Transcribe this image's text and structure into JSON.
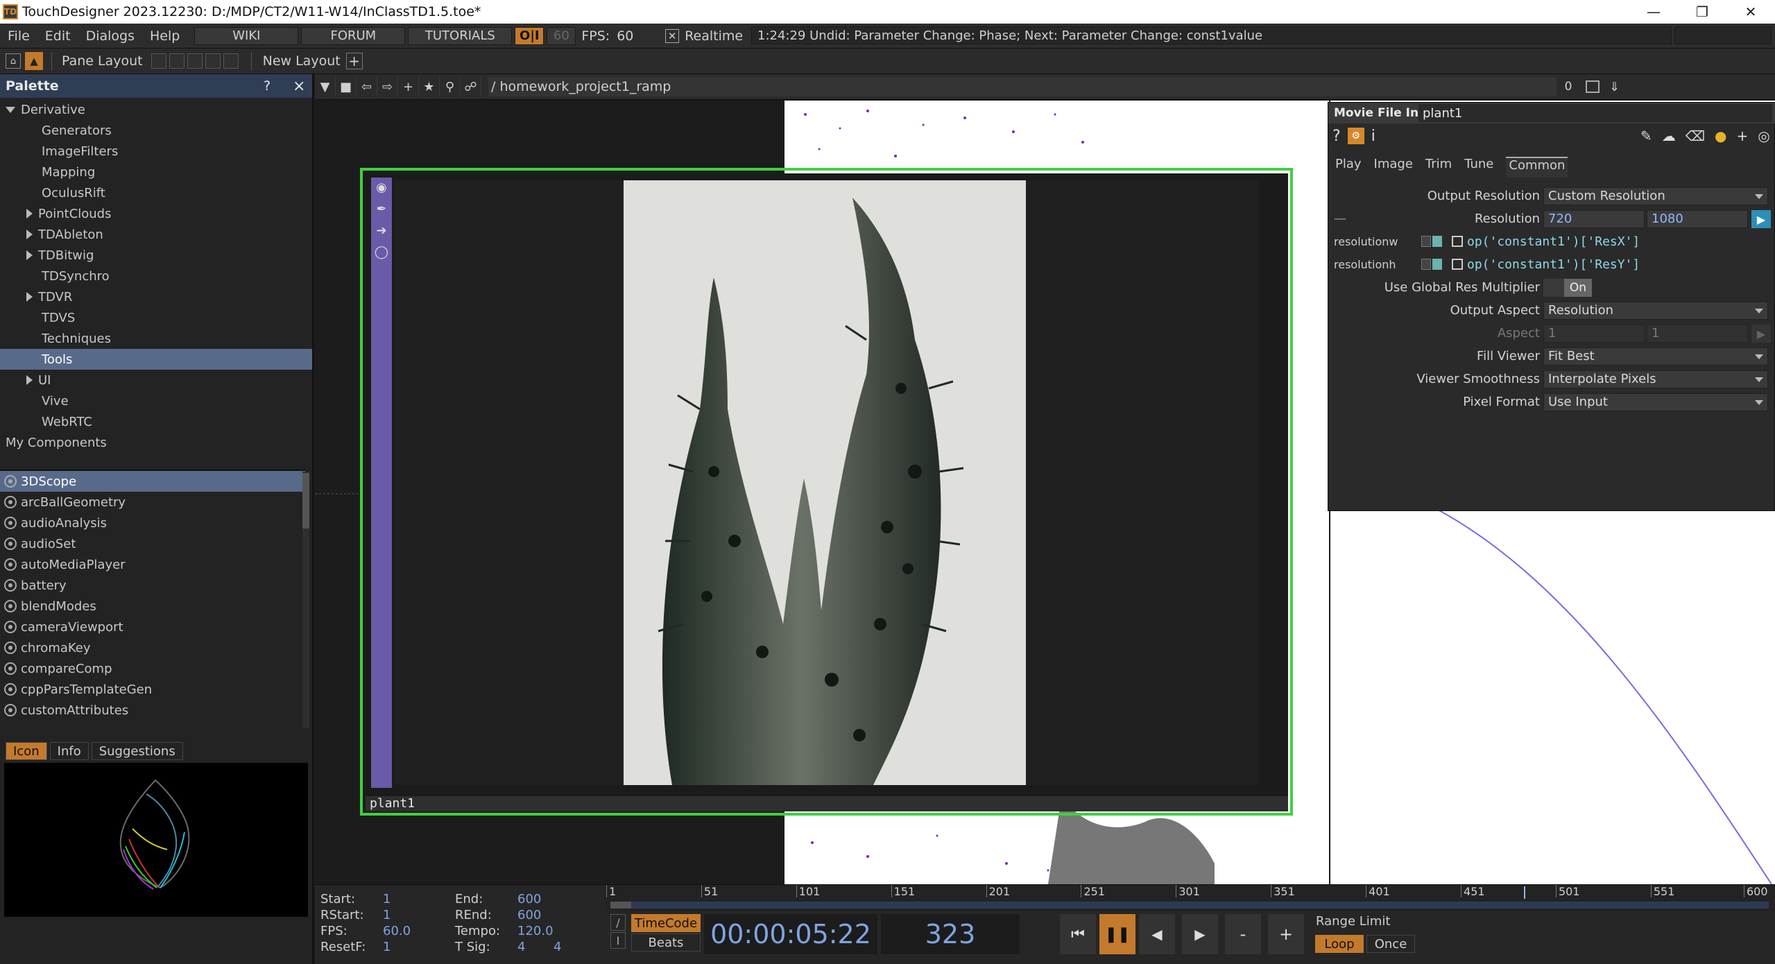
{
  "window": {
    "title": "TouchDesigner 2023.12230: D:/MDP/CT2/W11-W14/InClassTD1.5.toe*",
    "app_icon_label": "TD"
  },
  "menu": {
    "items": [
      "File",
      "Edit",
      "Dialogs",
      "Help"
    ],
    "wiki": "WIKI",
    "forum": "FORUM",
    "tutorials": "TUTORIALS",
    "oi": "O|I",
    "fps_target": "60",
    "fps_label": "FPS:",
    "fps_value": "60",
    "realtime_label": "Realtime",
    "realtime_checked": true,
    "status": "1:24:29 Undid: Parameter Change: Phase; Next: Parameter Change: const1value"
  },
  "toolbar": {
    "pane_layout": "Pane Layout",
    "new_layout": "New Layout"
  },
  "palette": {
    "title": "Palette",
    "help": "?",
    "close": "×",
    "tree": [
      {
        "label": "Derivative",
        "indent": 0,
        "arrow": "down",
        "selected": false
      },
      {
        "label": "Generators",
        "indent": 2,
        "arrow": "",
        "selected": false
      },
      {
        "label": "ImageFilters",
        "indent": 2,
        "arrow": "",
        "selected": false
      },
      {
        "label": "Mapping",
        "indent": 2,
        "arrow": "",
        "selected": false
      },
      {
        "label": "OculusRift",
        "indent": 2,
        "arrow": "",
        "selected": false
      },
      {
        "label": "PointClouds",
        "indent": 1,
        "arrow": "right",
        "selected": false
      },
      {
        "label": "TDAbleton",
        "indent": 1,
        "arrow": "right",
        "selected": false
      },
      {
        "label": "TDBitwig",
        "indent": 1,
        "arrow": "right",
        "selected": false
      },
      {
        "label": "TDSynchro",
        "indent": 2,
        "arrow": "",
        "selected": false
      },
      {
        "label": "TDVR",
        "indent": 1,
        "arrow": "right",
        "selected": false
      },
      {
        "label": "TDVS",
        "indent": 2,
        "arrow": "",
        "selected": false
      },
      {
        "label": "Techniques",
        "indent": 2,
        "arrow": "",
        "selected": false
      },
      {
        "label": "Tools",
        "indent": 2,
        "arrow": "",
        "selected": true
      },
      {
        "label": "UI",
        "indent": 1,
        "arrow": "right",
        "selected": false
      },
      {
        "label": "Vive",
        "indent": 2,
        "arrow": "",
        "selected": false
      },
      {
        "label": "WebRTC",
        "indent": 2,
        "arrow": "",
        "selected": false
      },
      {
        "label": "My Components",
        "indent": 0,
        "arrow": "",
        "selected": false
      }
    ],
    "components": [
      "3DScope",
      "arcBallGeometry",
      "audioAnalysis",
      "audioSet",
      "autoMediaPlayer",
      "battery",
      "blendModes",
      "cameraViewport",
      "chromaKey",
      "compareComp",
      "cppParsTemplateGen",
      "customAttributes"
    ],
    "selected_component": "3DScope",
    "tabs": [
      "Icon",
      "Info",
      "Suggestions"
    ],
    "active_tab": "Icon"
  },
  "network": {
    "path": "/ homework_project1_ramp",
    "counter": "0",
    "node_name": "plant1"
  },
  "params": {
    "op_type": "Movie File In",
    "op_name": "plant1",
    "tabs": [
      "Play",
      "Image",
      "Trim",
      "Tune",
      "Common"
    ],
    "active_tab": "Common",
    "rows": {
      "output_resolution_label": "Output Resolution",
      "output_resolution_value": "Custom Resolution",
      "resolution_label": "Resolution",
      "resolution_w": "720",
      "resolution_h": "1080",
      "resolutionw_label": "resolutionw",
      "resolutionw_expr": "op('constant1')['ResX']",
      "resolutionh_label": "resolutionh",
      "resolutionh_expr": "op('constant1')['ResY']",
      "global_res_label": "Use Global Res Multiplier",
      "global_res_value": "On",
      "output_aspect_label": "Output Aspect",
      "output_aspect_value": "Resolution",
      "aspect_label": "Aspect",
      "aspect_1": "1",
      "aspect_2": "1",
      "fill_viewer_label": "Fill Viewer",
      "fill_viewer_value": "Fit Best",
      "viewer_smooth_label": "Viewer Smoothness",
      "viewer_smooth_value": "Interpolate Pixels",
      "pixel_format_label": "Pixel Format",
      "pixel_format_value": "Use Input"
    }
  },
  "timeline": {
    "start_label": "Start:",
    "start": "1",
    "end_label": "End:",
    "end": "600",
    "rstart_label": "RStart:",
    "rstart": "1",
    "rend_label": "REnd:",
    "rend": "600",
    "fps_label": "FPS:",
    "fps": "60.0",
    "tempo_label": "Tempo:",
    "tempo": "120.0",
    "resetf_label": "ResetF:",
    "resetf": "1",
    "tsig_label": "T Sig:",
    "tsig_a": "4",
    "tsig_b": "4",
    "ticks": [
      "1",
      "51",
      "101",
      "151",
      "201",
      "251",
      "301",
      "351",
      "401",
      "451",
      "501",
      "551",
      "600"
    ],
    "timecode_btn": "TimeCode",
    "beats_btn": "Beats",
    "timecode": "00:00:05:22",
    "frame": "323",
    "range_limit": "Range Limit",
    "loop": "Loop",
    "once": "Once",
    "minus": "-",
    "plus": "+"
  }
}
